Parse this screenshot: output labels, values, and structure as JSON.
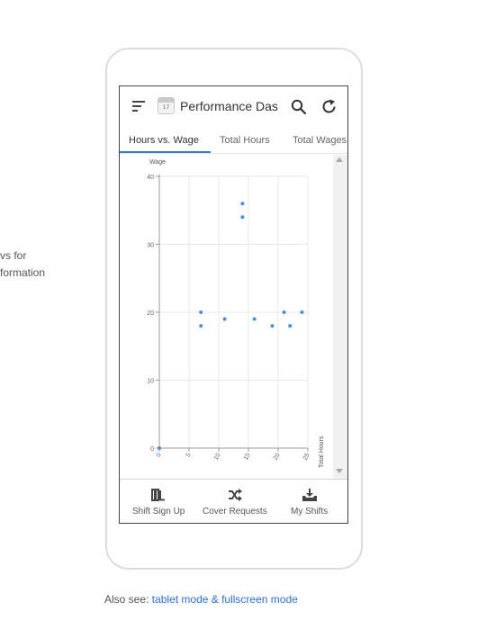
{
  "side_text": {
    "line1": "vs for",
    "line2": "formation"
  },
  "app": {
    "title": "Performance Das",
    "calendar_icon_number": "17",
    "icons": {
      "menu": "menu-icon",
      "app": "calendar-icon",
      "search": "search-icon",
      "refresh": "refresh-icon"
    }
  },
  "tabs": [
    {
      "label": "Hours vs. Wage",
      "active": true
    },
    {
      "label": "Total Hours",
      "active": false
    },
    {
      "label": "Total Wages",
      "active": false
    }
  ],
  "chart_data": {
    "type": "scatter",
    "xlabel": "Total Hours",
    "ylabel": "Wage",
    "xlim": [
      0,
      25
    ],
    "ylim": [
      0,
      40
    ],
    "x_ticks": [
      "0",
      "5",
      "10",
      "15",
      "20",
      "25"
    ],
    "y_ticks": [
      "0",
      "10",
      "20",
      "30",
      "40"
    ],
    "grid": true,
    "color": "#4a90d9",
    "points": [
      {
        "x": 0,
        "y": 0
      },
      {
        "x": 7,
        "y": 20
      },
      {
        "x": 7,
        "y": 18
      },
      {
        "x": 11,
        "y": 19
      },
      {
        "x": 14,
        "y": 36
      },
      {
        "x": 14,
        "y": 34
      },
      {
        "x": 16,
        "y": 19
      },
      {
        "x": 19,
        "y": 18
      },
      {
        "x": 21,
        "y": 20
      },
      {
        "x": 22,
        "y": 18
      },
      {
        "x": 24,
        "y": 20
      }
    ]
  },
  "bottom_nav": [
    {
      "label": "Shift Sign Up",
      "icon": "door-exit-icon"
    },
    {
      "label": "Cover Requests",
      "icon": "shuffle-icon"
    },
    {
      "label": "My Shifts",
      "icon": "inbox-download-icon"
    }
  ],
  "footer": {
    "prefix": "Also see: ",
    "link": "tablet mode & fullscreen mode"
  },
  "colors": {
    "accent": "#3a7bd5",
    "link": "#2d6fcf",
    "point": "#4a90d9"
  }
}
